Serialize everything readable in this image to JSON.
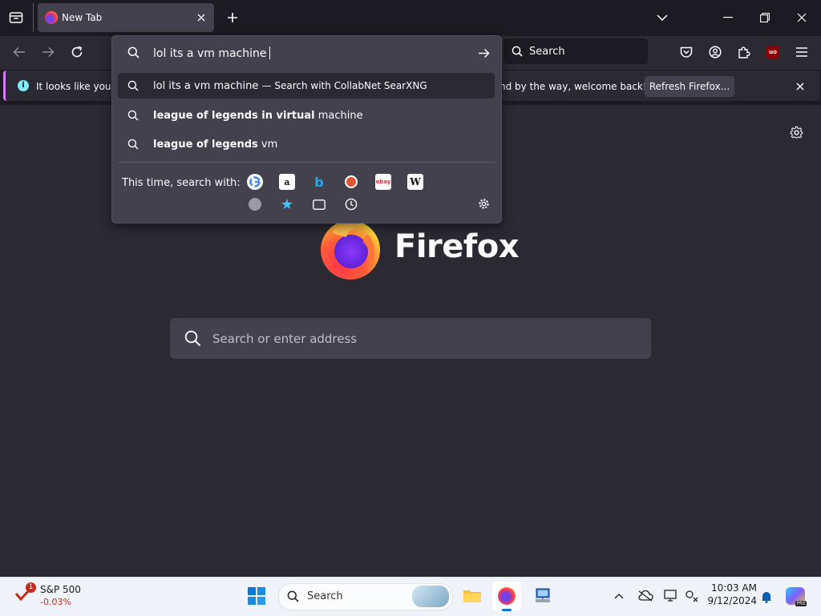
{
  "browser": {
    "tab": {
      "title": "New Tab"
    },
    "toolbar_search_placeholder": "Search"
  },
  "infobar": {
    "text_left": "It looks like you ha",
    "text_right": "nd by the way, welcome back!",
    "refresh_label": "Refresh Firefox..."
  },
  "urlbar": {
    "typed_text": "lol its a vm machine",
    "suggestions": [
      {
        "bold": "",
        "normal": "lol its a vm machine",
        "suffix": "— Search with CollabNet SearXNG"
      },
      {
        "bold": "league of legends in virtual",
        "normal": " machine",
        "suffix": ""
      },
      {
        "bold": "league of legends",
        "normal": " vm",
        "suffix": ""
      }
    ],
    "engines_label": "This time, search with:",
    "engines": [
      "google-icon",
      "amazon-icon",
      "bing-icon",
      "duckduckgo-icon",
      "ebay-icon",
      "wikipedia-icon",
      "searxng-icon",
      "bookmarks-icon",
      "tabs-icon",
      "history-icon"
    ]
  },
  "newtab": {
    "brand": "Firefox",
    "search_placeholder": "Search or enter address"
  },
  "taskbar": {
    "stock_name": "S&P 500",
    "stock_change": "-0.03%",
    "stock_badge": "1",
    "search_label": "Search",
    "time": "10:03 AM",
    "date": "9/12/2024"
  },
  "colors": {
    "accent": "#d77cff",
    "stock_negative": "#c42b1c"
  }
}
